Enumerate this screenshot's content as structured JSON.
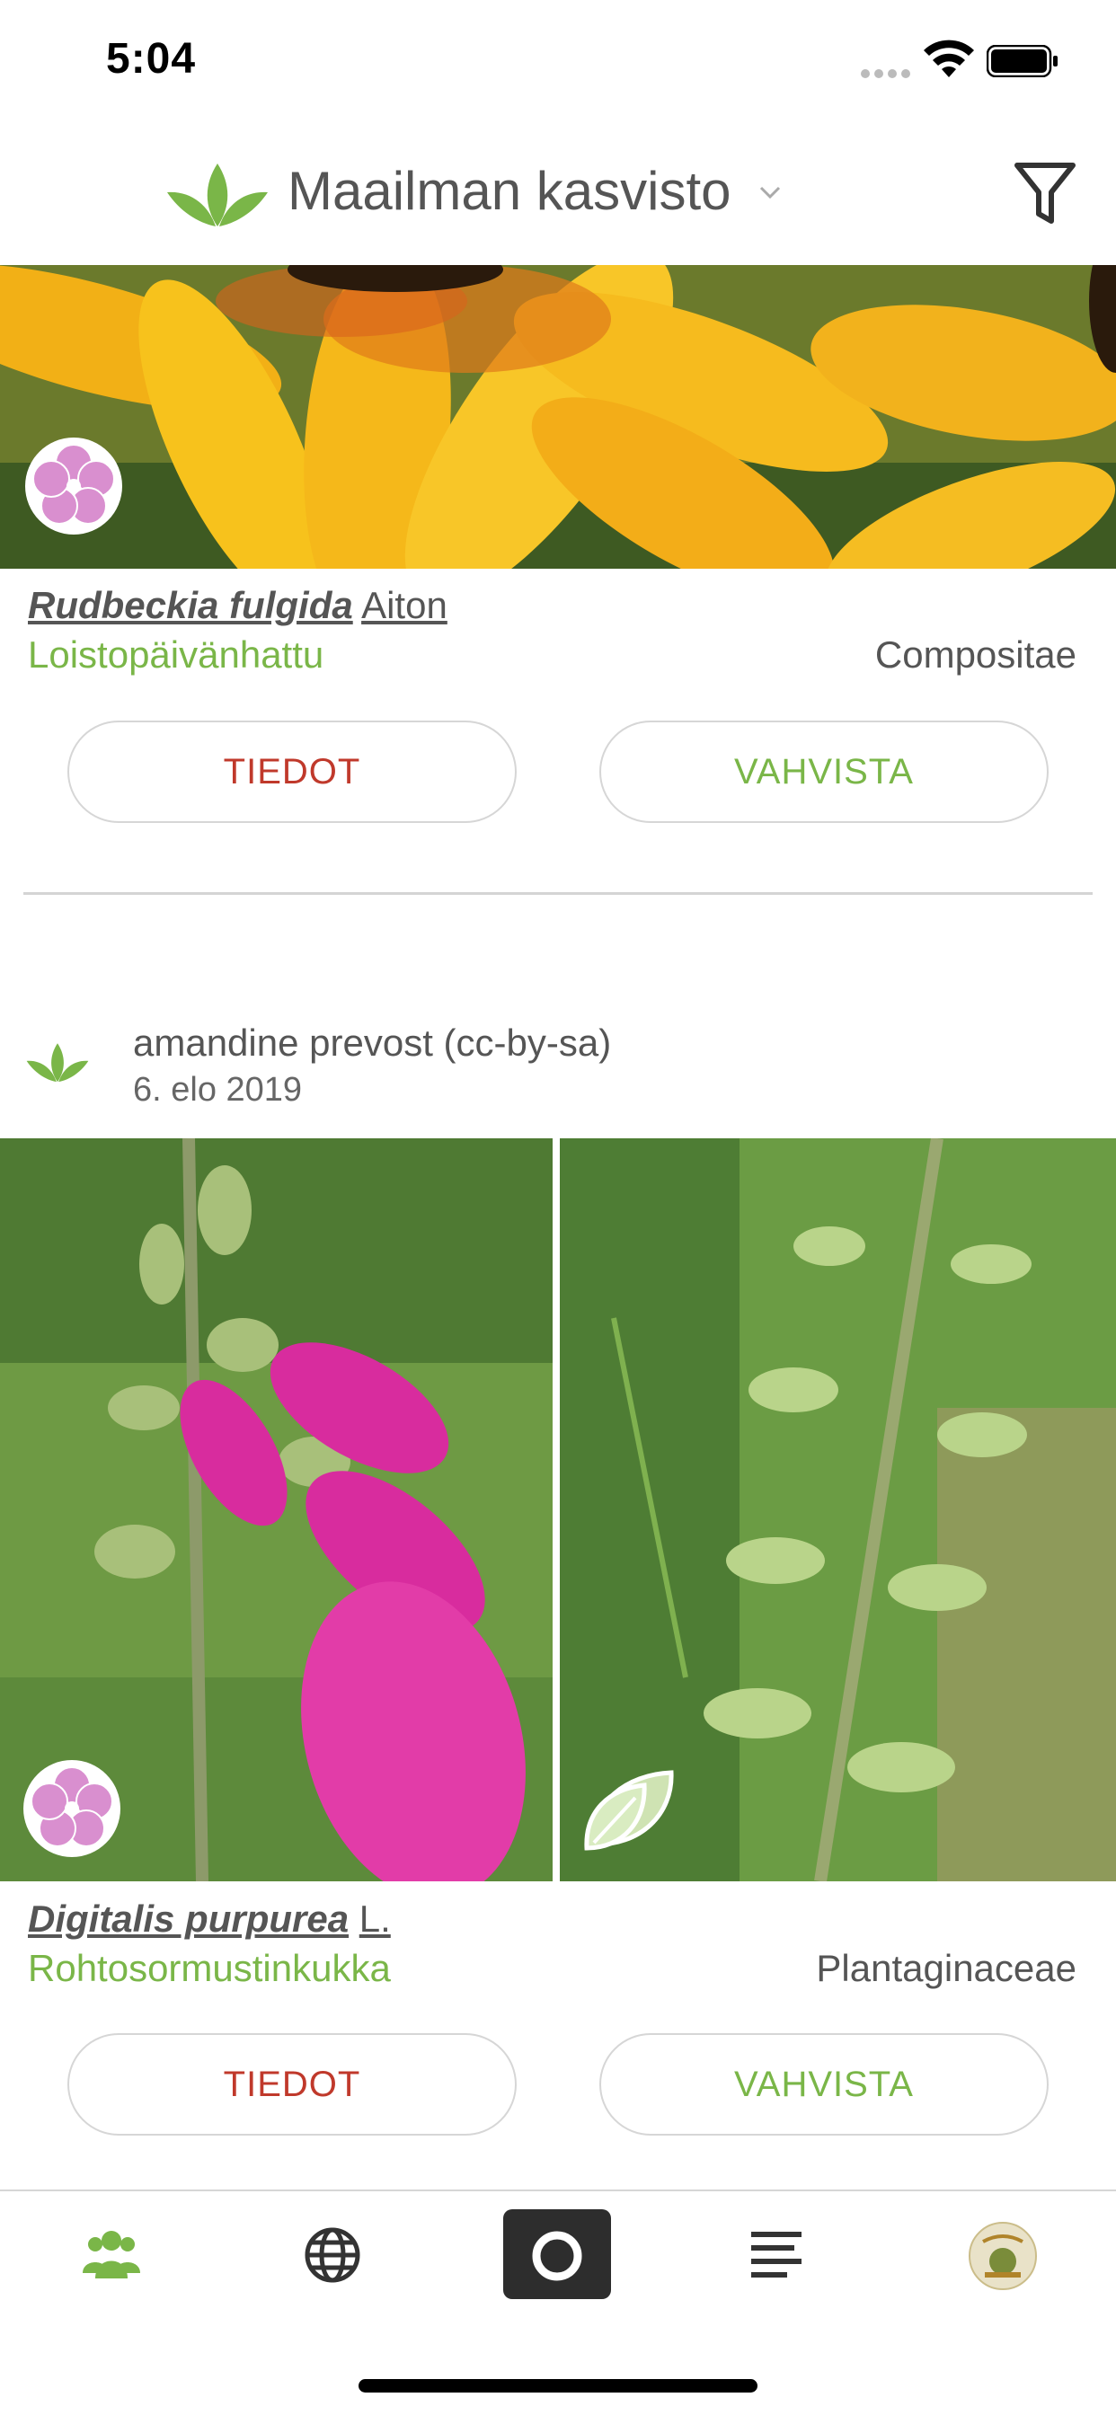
{
  "status_bar": {
    "time": "5:04"
  },
  "header": {
    "title": "Maailman kasvisto"
  },
  "observations": [
    {
      "scientific_genus_species": "Rudbeckia fulgida",
      "scientific_author": "Aiton",
      "common_name": "Loistopäivänhattu",
      "family": "Compositae",
      "info_label": "TIEDOT",
      "confirm_label": "VAHVISTA"
    },
    {
      "author": "amandine prevost (cc-by-sa)",
      "date": "6. elo 2019",
      "scientific_genus_species": "Digitalis purpurea",
      "scientific_author": "L.",
      "common_name": "Rohtosormustinkukka",
      "family": "Plantaginaceae",
      "info_label": "TIEDOT",
      "confirm_label": "VAHVISTA"
    }
  ],
  "tabbar": {
    "items": [
      {
        "icon": "people-icon",
        "active": true
      },
      {
        "icon": "globe-icon",
        "active": false
      },
      {
        "icon": "camera-icon",
        "active": false
      },
      {
        "icon": "list-icon",
        "active": false
      },
      {
        "icon": "profile-avatar",
        "active": false
      }
    ]
  },
  "colors": {
    "accent_green": "#7ab648",
    "info_red": "#c0392b",
    "text_gray": "#555555"
  }
}
